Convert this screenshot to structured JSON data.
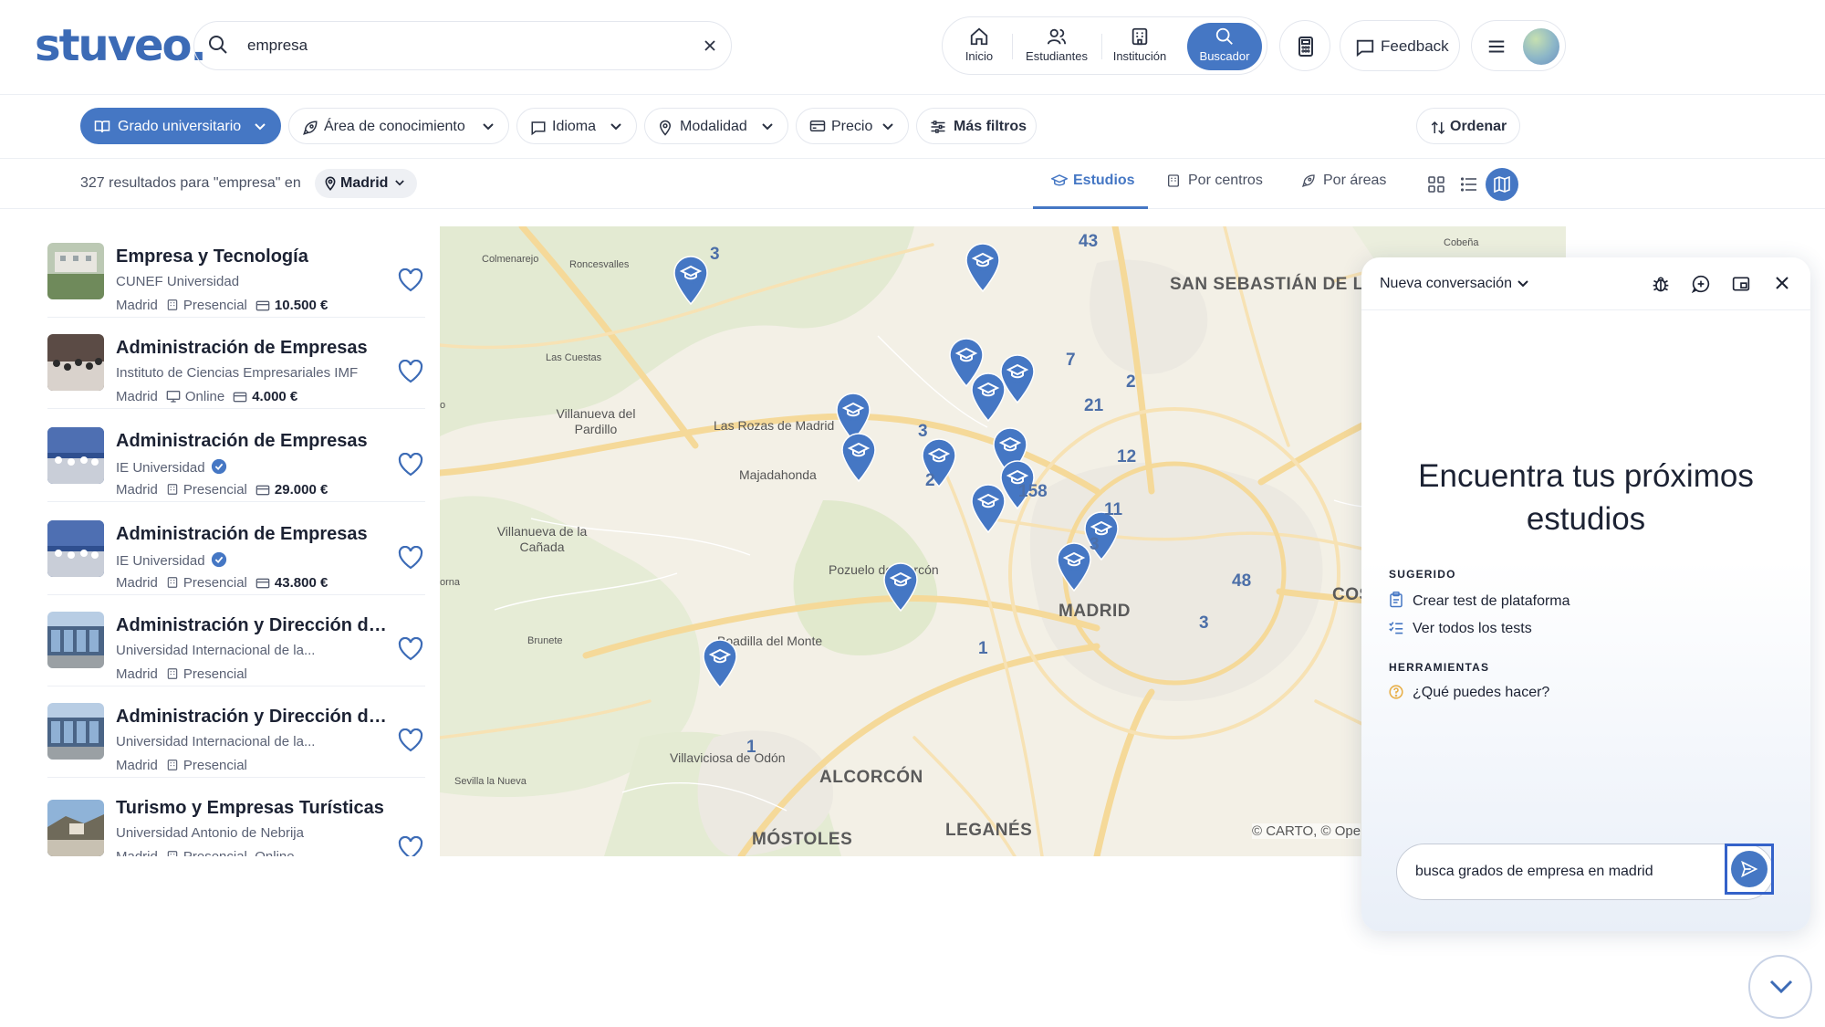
{
  "header": {
    "logo": "stuveo.",
    "search": {
      "value": "empresa"
    },
    "nav": [
      {
        "label": "Inicio",
        "icon": "home-icon"
      },
      {
        "label": "Estudiantes",
        "icon": "users-icon"
      },
      {
        "label": "Institución",
        "icon": "building-icon"
      },
      {
        "label": "Buscador",
        "icon": "search-icon",
        "active": true
      }
    ],
    "feedback_label": "Feedback"
  },
  "filters": [
    {
      "label": "Grado universitario",
      "icon": "book-icon",
      "primary": true
    },
    {
      "label": "Área de conocimiento",
      "icon": "rocket-icon"
    },
    {
      "label": "Idioma",
      "icon": "speech-bubble-icon"
    },
    {
      "label": "Modalidad",
      "icon": "location-pin-icon"
    },
    {
      "label": "Precio",
      "icon": "money-icon"
    },
    {
      "label": "Más filtros",
      "icon": "sliders-icon"
    }
  ],
  "sort_label": "Ordenar",
  "results": {
    "count_text": "327 resultados para \"empresa\" en",
    "location": "Madrid"
  },
  "view_tabs": [
    {
      "label": "Estudios",
      "icon": "graduation-cap-icon",
      "active": true
    },
    {
      "label": "Por centros",
      "icon": "building-icon"
    },
    {
      "label": "Por áreas",
      "icon": "rocket-icon"
    }
  ],
  "list": [
    {
      "title": "Empresa y Tecnología",
      "institution": "CUNEF Universidad",
      "verified": false,
      "city": "Madrid",
      "modality": "Presencial",
      "modality_icon": "building-icon",
      "price": "10.500 €"
    },
    {
      "title": "Administración de Empresas",
      "institution": "Instituto de Ciencias Empresariales IMF",
      "verified": false,
      "city": "Madrid",
      "modality": "Online",
      "modality_icon": "monitor-icon",
      "price": "4.000 €"
    },
    {
      "title": "Administración de Empresas",
      "institution": "IE Universidad",
      "verified": true,
      "city": "Madrid",
      "modality": "Presencial",
      "modality_icon": "building-icon",
      "price": "29.000 €"
    },
    {
      "title": "Administración de Empresas",
      "institution": "IE Universidad",
      "verified": true,
      "city": "Madrid",
      "modality": "Presencial",
      "modality_icon": "building-icon",
      "price": "43.800 €"
    },
    {
      "title": "Administración y Dirección de...",
      "institution": "Universidad Internacional de la...",
      "verified": false,
      "city": "Madrid",
      "modality": "Presencial",
      "modality_icon": "building-icon",
      "price": ""
    },
    {
      "title": "Administración y Dirección de...",
      "institution": "Universidad Internacional de la...",
      "verified": false,
      "city": "Madrid",
      "modality": "Presencial",
      "modality_icon": "building-icon",
      "price": ""
    },
    {
      "title": "Turismo y Empresas Turísticas",
      "institution": "Universidad Antonio de Nebrija",
      "verified": false,
      "city": "Madrid",
      "modality": "Presencial, Online",
      "modality_icon": "building-icon",
      "price": ""
    }
  ],
  "map": {
    "labels": {
      "colmenarejo": "Colmenarejo",
      "roncesvalles": "Roncesvalles",
      "cobena": "Cobeña",
      "san_sebastian": "SAN SEBASTIÁN DE LOS REYES",
      "las_cuestas": "Las Cuestas",
      "villanueva_pardillo": "Villanueva del Pardillo",
      "las_rozas": "Las Rozas de Madrid",
      "majadahonda": "Majadahonda",
      "villanueva_canada": "Villanueva de la Cañada",
      "pozuelo": "Pozuelo de Alarcón",
      "madrid": "MADRID",
      "cos": "COS",
      "brunete": "Brunete",
      "boadilla": "Boadilla del Monte",
      "villaviciosa": "Villaviciosa de Odón",
      "alcorcon": "ALCORCÓN",
      "sevilla_nueva": "Sevilla la Nueva",
      "mostoles": "MÓSTOLES",
      "leganes": "LEGANÉS",
      "edge_o": "o",
      "edge_orna": "orna"
    },
    "marker_counts": [
      "3",
      "43",
      "7",
      "2",
      "21",
      "12",
      "3",
      "2",
      "158",
      "11",
      "3",
      "48",
      "3",
      "1",
      "1"
    ],
    "attribution": "© CARTO, © Ope"
  },
  "chat": {
    "conversation_label": "Nueva conversación",
    "heading": "Encuentra tus próximos estudios",
    "suggested_title": "SUGERIDO",
    "suggested": [
      {
        "label": "Crear test de plataforma",
        "icon": "clipboard-icon"
      },
      {
        "label": "Ver todos los tests",
        "icon": "checklist-icon"
      }
    ],
    "tools_title": "HERRAMIENTAS",
    "tools": [
      {
        "label": "¿Qué puedes hacer?",
        "icon": "help-circle-icon"
      }
    ],
    "input_value": "busca grados de empresa en madrid"
  },
  "colors": {
    "accent": "#4577c4",
    "marker": "#4577c4",
    "logo": "#3c6bb6"
  }
}
